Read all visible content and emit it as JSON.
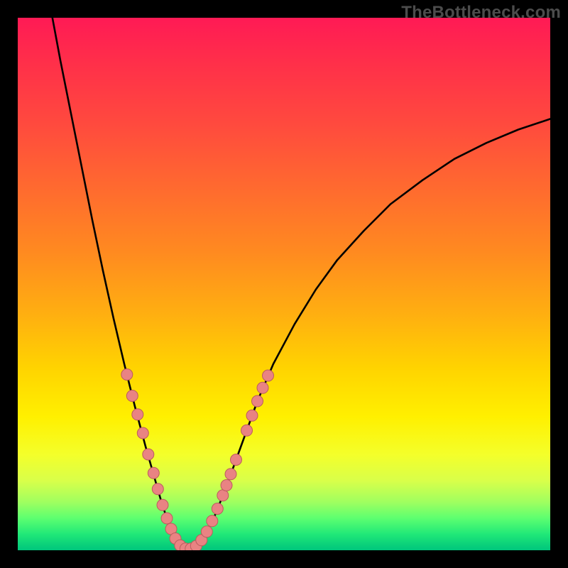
{
  "watermark": "TheBottleneck.com",
  "colors": {
    "background": "#000000",
    "curve": "#000000",
    "dot_fill": "#e98383",
    "dot_stroke": "#bb5d5d",
    "gradient_stops": [
      "#ff1a55",
      "#ff4a3e",
      "#ff8a20",
      "#ffd400",
      "#fff000",
      "#9fff60",
      "#20e878",
      "#00c77d"
    ]
  },
  "chart_data": {
    "type": "line",
    "title": "",
    "xlabel": "",
    "ylabel": "",
    "xlim": [
      0,
      100
    ],
    "ylim": [
      0,
      100
    ],
    "grid": false,
    "description": "V-shaped bottleneck curve over a red-to-green vertical gradient. The curve descends steeply from top-left, reaches zero near x≈30, then rises with a gentler convex slope toward x≈100, y≈80. Pink dots highlight sample points on both flanks of the V near the trough.",
    "curve_points": [
      {
        "x": 6.5,
        "y": 100.0
      },
      {
        "x": 8.0,
        "y": 92.0
      },
      {
        "x": 10.0,
        "y": 82.0
      },
      {
        "x": 12.0,
        "y": 72.0
      },
      {
        "x": 14.0,
        "y": 62.0
      },
      {
        "x": 16.0,
        "y": 52.5
      },
      {
        "x": 18.0,
        "y": 43.5
      },
      {
        "x": 20.0,
        "y": 35.0
      },
      {
        "x": 22.0,
        "y": 27.0
      },
      {
        "x": 24.0,
        "y": 19.5
      },
      {
        "x": 26.0,
        "y": 12.5
      },
      {
        "x": 27.0,
        "y": 9.0
      },
      {
        "x": 28.0,
        "y": 6.0
      },
      {
        "x": 29.0,
        "y": 3.2
      },
      {
        "x": 30.0,
        "y": 1.2
      },
      {
        "x": 31.0,
        "y": 0.3
      },
      {
        "x": 32.0,
        "y": 0.0
      },
      {
        "x": 33.0,
        "y": 0.2
      },
      {
        "x": 34.0,
        "y": 1.0
      },
      {
        "x": 35.0,
        "y": 2.5
      },
      {
        "x": 37.0,
        "y": 6.5
      },
      {
        "x": 39.0,
        "y": 11.5
      },
      {
        "x": 41.0,
        "y": 17.0
      },
      {
        "x": 43.0,
        "y": 22.5
      },
      {
        "x": 45.0,
        "y": 28.0
      },
      {
        "x": 48.0,
        "y": 35.0
      },
      {
        "x": 52.0,
        "y": 42.5
      },
      {
        "x": 56.0,
        "y": 49.0
      },
      {
        "x": 60.0,
        "y": 54.5
      },
      {
        "x": 65.0,
        "y": 60.0
      },
      {
        "x": 70.0,
        "y": 65.0
      },
      {
        "x": 76.0,
        "y": 69.5
      },
      {
        "x": 82.0,
        "y": 73.5
      },
      {
        "x": 88.0,
        "y": 76.5
      },
      {
        "x": 94.0,
        "y": 79.0
      },
      {
        "x": 100.0,
        "y": 81.0
      }
    ],
    "dots": [
      {
        "x": 20.5,
        "y": 33.0
      },
      {
        "x": 21.5,
        "y": 29.0
      },
      {
        "x": 22.5,
        "y": 25.5
      },
      {
        "x": 23.5,
        "y": 22.0
      },
      {
        "x": 24.5,
        "y": 18.0
      },
      {
        "x": 25.5,
        "y": 14.5
      },
      {
        "x": 26.3,
        "y": 11.5
      },
      {
        "x": 27.2,
        "y": 8.5
      },
      {
        "x": 28.0,
        "y": 6.0
      },
      {
        "x": 28.8,
        "y": 4.0
      },
      {
        "x": 29.6,
        "y": 2.2
      },
      {
        "x": 30.5,
        "y": 0.9
      },
      {
        "x": 31.5,
        "y": 0.3
      },
      {
        "x": 32.5,
        "y": 0.3
      },
      {
        "x": 33.5,
        "y": 0.8
      },
      {
        "x": 34.5,
        "y": 1.9
      },
      {
        "x": 35.5,
        "y": 3.5
      },
      {
        "x": 36.5,
        "y": 5.5
      },
      {
        "x": 37.5,
        "y": 7.8
      },
      {
        "x": 38.5,
        "y": 10.3
      },
      {
        "x": 39.2,
        "y": 12.2
      },
      {
        "x": 40.0,
        "y": 14.3
      },
      {
        "x": 41.0,
        "y": 17.0
      },
      {
        "x": 43.0,
        "y": 22.5
      },
      {
        "x": 44.0,
        "y": 25.3
      },
      {
        "x": 45.0,
        "y": 28.0
      },
      {
        "x": 46.0,
        "y": 30.5
      },
      {
        "x": 47.0,
        "y": 32.8
      }
    ]
  }
}
